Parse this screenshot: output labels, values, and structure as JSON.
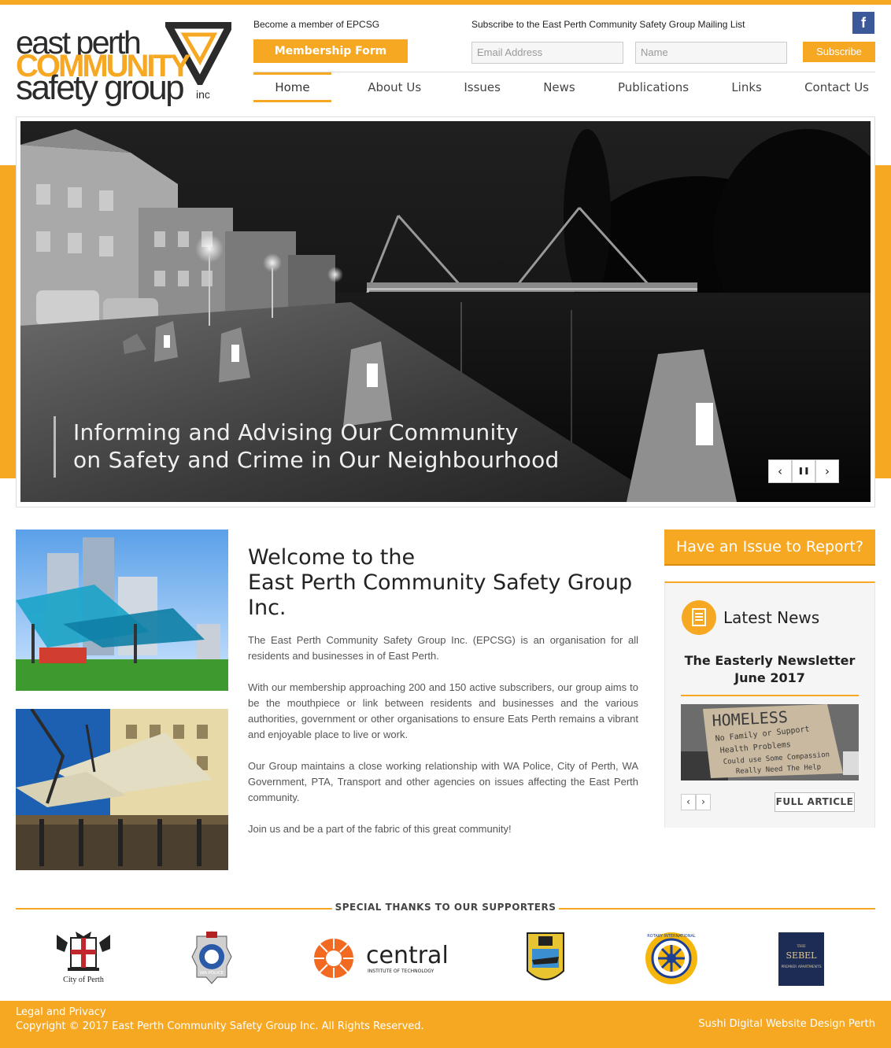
{
  "brand": {
    "logo_line1": "east perth",
    "logo_line2": "COMMUNITY",
    "logo_line3": "safety group",
    "logo_line4": "inc",
    "accent_color": "#f7a823"
  },
  "header": {
    "member_label": "Become a member of EPCSG",
    "member_button": "Membership Form",
    "subscribe_label": "Subscribe to the East Perth Community Safety Group Mailing List",
    "email_placeholder": "Email Address",
    "name_placeholder": "Name",
    "subscribe_button": "Subscribe",
    "facebook_letter": "f"
  },
  "nav": {
    "items": [
      "Home",
      "About Us",
      "Issues",
      "News",
      "Publications",
      "Links",
      "Contact Us"
    ],
    "active": "Home"
  },
  "hero": {
    "caption_line1": "Informing and Advising Our Community",
    "caption_line2": "on Safety and Crime in Our Neighbourhood",
    "prev": "‹",
    "pause": "❚❚",
    "next": "›"
  },
  "welcome": {
    "heading_line1": "Welcome to the",
    "heading_line2": "East Perth Community Safety Group",
    "heading_line3": "Inc.",
    "paragraphs": [
      "The East Perth Community Safety Group Inc. (EPCSG) is an organisation for all residents and businesses in of East Perth.",
      "With our membership approaching 200 and 150 active subscribers, our group aims to be the mouthpiece or link between residents and businesses and the various authorities, government or other organisations to ensure Eats Perth remains a vibrant and enjoyable place to live or work.",
      "Our Group maintains a close working relationship with WA Police, City of Perth, WA Government, PTA, Transport and other agencies on issues affecting the East Perth community.",
      "Join us and be a part of the fabric of this great community!"
    ]
  },
  "sidebar": {
    "issue_button": "Have an Issue to Report?",
    "news_title": "Latest News",
    "headline_line1": "The Easterly Newsletter",
    "headline_line2": "June 2017",
    "sign_text": [
      "HOMELESS",
      "No Family or Support",
      "Health Problems",
      "Could use Some Compassion",
      "Really Need The Help"
    ],
    "full_article": "FULL ARTICLE",
    "prev": "‹",
    "next": "›"
  },
  "supporters": {
    "title": "SPECIAL THANKS TO OUR SUPPORTERS",
    "city_of_perth": "City of Perth",
    "wa_police": "WA POLICE",
    "central_name": "central",
    "central_sub": "INSTITUTE OF TECHNOLOGY",
    "rotary": "ROTARY INTERNATIONAL",
    "sebel_small": "THE",
    "sebel_name": "SEBEL",
    "sebel_sub": "PREMIER APARTMENTS"
  },
  "footer": {
    "legal": "Legal and Privacy",
    "copyright": "Copyright © 2017 East Perth Community Safety Group Inc. All Rights Reserved.",
    "credit": "Sushi Digital Website Design Perth"
  }
}
